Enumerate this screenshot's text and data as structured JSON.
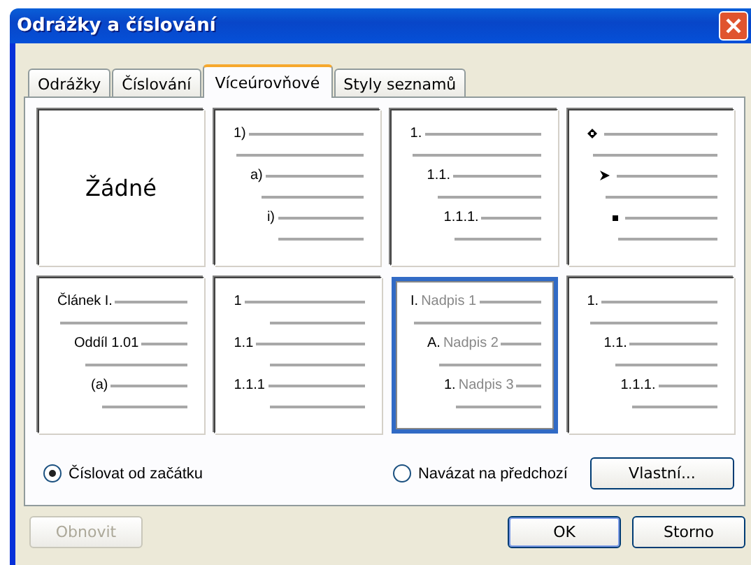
{
  "window": {
    "title": "Odrážky a číslování"
  },
  "tabs": [
    {
      "label": "Odrážky",
      "selected": false
    },
    {
      "label": "Číslování",
      "selected": false
    },
    {
      "label": "Víceúrovňové",
      "selected": true
    },
    {
      "label": "Styly seznamů",
      "selected": false
    }
  ],
  "preset_rows": [
    [
      {
        "kind": "none",
        "label": "Žádné",
        "selected": false
      },
      {
        "kind": "outline",
        "selected": false,
        "levels": [
          {
            "marker": "1)"
          },
          {
            "marker": "a)"
          },
          {
            "marker": "i)"
          }
        ]
      },
      {
        "kind": "outline",
        "selected": false,
        "levels": [
          {
            "marker": "1."
          },
          {
            "marker": "1.1."
          },
          {
            "marker": "1.1.1."
          }
        ]
      },
      {
        "kind": "bullets",
        "selected": false
      }
    ],
    [
      {
        "kind": "outline",
        "selected": false,
        "levels": [
          {
            "marker": "Článek I."
          },
          {
            "marker": "Oddíl 1.01"
          },
          {
            "marker": "(a)"
          }
        ]
      },
      {
        "kind": "flat",
        "selected": false,
        "levels": [
          {
            "marker": "1"
          },
          {
            "marker": "1.1"
          },
          {
            "marker": "1.1.1"
          }
        ]
      },
      {
        "kind": "outline",
        "selected": true,
        "levels": [
          {
            "marker": "I.",
            "text": "Nadpis 1"
          },
          {
            "marker": "A.",
            "text": "Nadpis 2"
          },
          {
            "marker": "1.",
            "text": "Nadpis 3"
          }
        ]
      },
      {
        "kind": "outline",
        "selected": false,
        "levels": [
          {
            "marker": "1."
          },
          {
            "marker": "1.1."
          },
          {
            "marker": "1.1.1."
          }
        ]
      }
    ]
  ],
  "radios": [
    {
      "label": "Číslovat od začátku",
      "selected": true
    },
    {
      "label": "Navázat na předchozí",
      "selected": false
    }
  ],
  "customize_button": "Vlastní...",
  "buttons": [
    {
      "label": "Obnovit",
      "disabled": true,
      "default": false
    },
    {
      "label": "OK",
      "disabled": false,
      "default": true
    },
    {
      "label": "Storno",
      "disabled": false,
      "default": false
    }
  ]
}
